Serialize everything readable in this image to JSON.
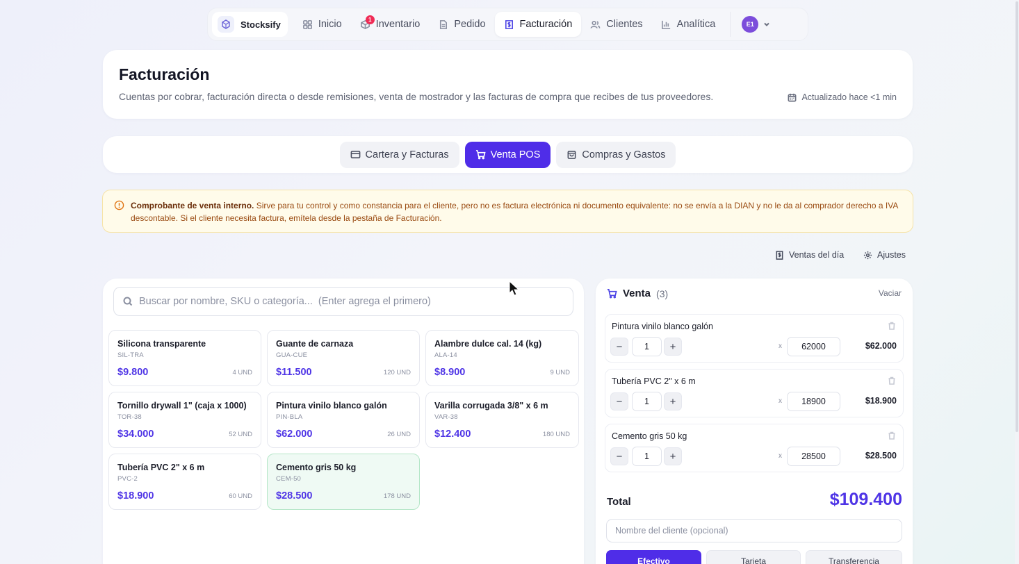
{
  "nav": {
    "brand": "Stocksify",
    "items": [
      {
        "label": "Inicio",
        "icon": "grid-icon"
      },
      {
        "label": "Inventario",
        "icon": "box-icon",
        "badge": "1"
      },
      {
        "label": "Pedido",
        "icon": "document-icon"
      },
      {
        "label": "Facturación",
        "icon": "invoice-icon",
        "active": true
      },
      {
        "label": "Clientes",
        "icon": "users-icon"
      },
      {
        "label": "Analítica",
        "icon": "bar-chart-icon"
      }
    ],
    "user_initials": "E1"
  },
  "header": {
    "title": "Facturación",
    "subtitle": "Cuentas por cobrar, facturación directa o desde remisiones, venta de mostrador y las facturas de compra que recibes de tus proveedores.",
    "updated": "Actualizado hace <1 min"
  },
  "tabs": [
    {
      "label": "Cartera y Facturas"
    },
    {
      "label": "Venta POS",
      "active": true
    },
    {
      "label": "Compras y Gastos"
    }
  ],
  "notice": {
    "bold": "Comprobante de venta interno.",
    "text": " Sirve para tu control y como constancia para el cliente, pero no es factura electrónica ni documento equivalente: no se envía a la DIAN y no le da al comprador derecho a IVA descontable. Si el cliente necesita factura, emítela desde la pestaña de Facturación."
  },
  "actions": {
    "sales_today": "Ventas del día",
    "settings": "Ajustes"
  },
  "search": {
    "placeholder": "Buscar por nombre, SKU o categoría...  (Enter agrega el primero)",
    "value": ""
  },
  "products": [
    {
      "name": "Silicona transparente",
      "sku": "SIL-TRA",
      "price": "$9.800",
      "stock": "4 UND"
    },
    {
      "name": "Guante de carnaza",
      "sku": "GUA-CUE",
      "price": "$11.500",
      "stock": "120 UND"
    },
    {
      "name": "Alambre dulce cal. 14 (kg)",
      "sku": "ALA-14",
      "price": "$8.900",
      "stock": "9 UND"
    },
    {
      "name": "Tornillo drywall 1\" (caja x 1000)",
      "sku": "TOR-38",
      "price": "$34.000",
      "stock": "52 UND"
    },
    {
      "name": "Pintura vinilo blanco galón",
      "sku": "PIN-BLA",
      "price": "$62.000",
      "stock": "26 UND"
    },
    {
      "name": "Varilla corrugada 3/8\" x 6 m",
      "sku": "VAR-38",
      "price": "$12.400",
      "stock": "180 UND"
    },
    {
      "name": "Tubería PVC 2\" x 6 m",
      "sku": "PVC-2",
      "price": "$18.900",
      "stock": "60 UND"
    },
    {
      "name": "Cemento gris 50 kg",
      "sku": "CEM-50",
      "price": "$28.500",
      "stock": "178 UND",
      "selected": true
    }
  ],
  "cart": {
    "title": "Venta",
    "count": "(3)",
    "clear": "Vaciar",
    "lines": [
      {
        "name": "Pintura vinilo blanco galón",
        "qty": "1",
        "unit_price": "62000",
        "subtotal": "$62.000"
      },
      {
        "name": "Tubería PVC 2\" x 6 m",
        "qty": "1",
        "unit_price": "18900",
        "subtotal": "$18.900"
      },
      {
        "name": "Cemento gris 50 kg",
        "qty": "1",
        "unit_price": "28500",
        "subtotal": "$28.500"
      }
    ],
    "minus": "−",
    "plus": "+",
    "times": "x",
    "total_label": "Total",
    "total": "$109.400",
    "client_placeholder": "Nombre del cliente (opcional)",
    "payment_methods": [
      {
        "label": "Efectivo",
        "active": true
      },
      {
        "label": "Tarjeta"
      },
      {
        "label": "Transferencia"
      }
    ]
  },
  "colors": {
    "accent": "#4f2de8",
    "price": "#4f35e6",
    "notice_bg": "#fffbea",
    "badge": "#ef2b55"
  }
}
